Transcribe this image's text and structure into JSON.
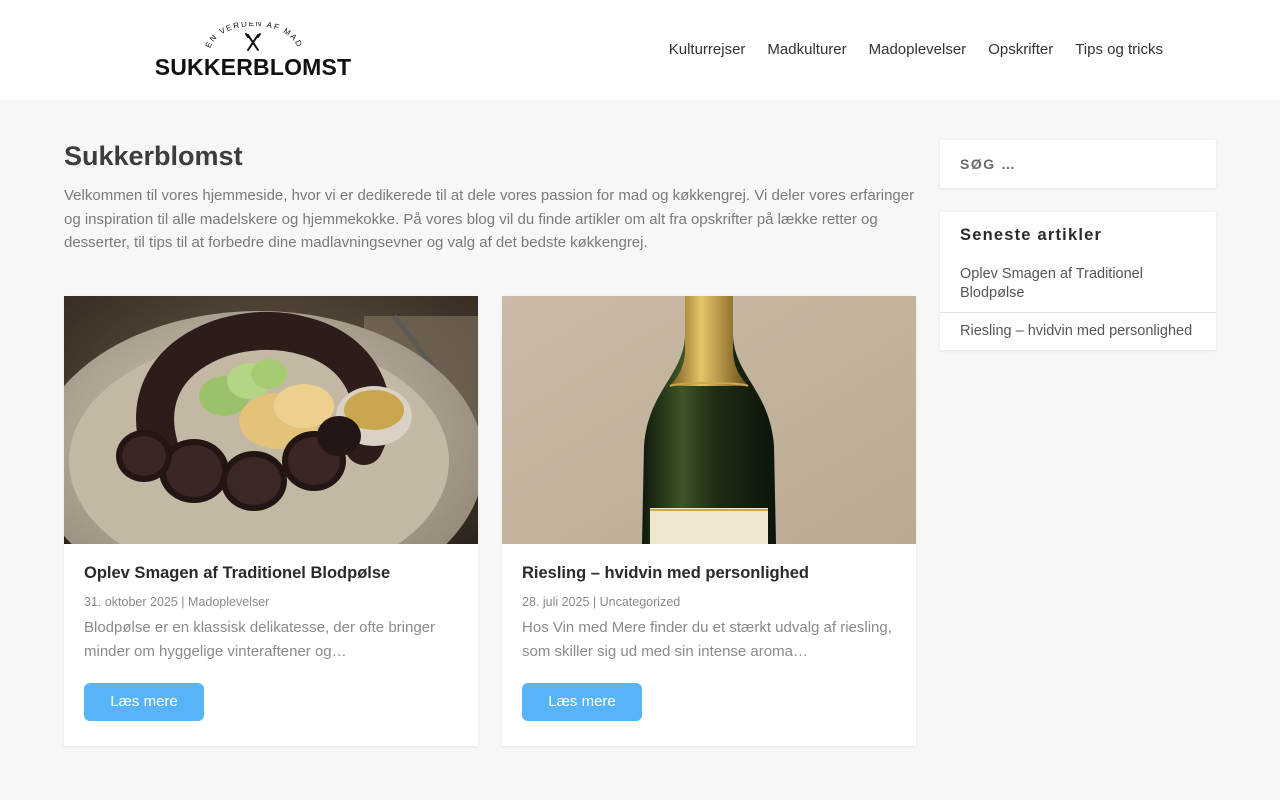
{
  "site": {
    "logo_tagline": "EN VERDEN AF MAD",
    "logo_name": "SUKKERBLOMST"
  },
  "nav": [
    "Kulturrejser",
    "Madkulturer",
    "Madoplevelser",
    "Opskrifter",
    "Tips og tricks"
  ],
  "main": {
    "title": "Sukkerblomst",
    "intro": "Velkommen til vores hjemmeside, hvor vi er dedikerede til at dele vores passion for mad og køkkengrej. Vi deler vores erfaringer og inspiration til alle madelskere og hjemmekokke. På vores blog vil du finde artikler om alt fra opskrifter på lække retter og desserter, til tips til at forbedre dine madlavningsevner og valg af det bedste køkkengrej."
  },
  "posts": [
    {
      "title": "Oplev Smagen af Traditionel Blodpølse",
      "date": "31. oktober 2025",
      "separator": " | ",
      "category": "Madoplevelser",
      "excerpt": "Blodpølse er en klassisk delikatesse, der ofte bringer minder om hyggelige vinteraftener og…",
      "button": "Læs mere",
      "image": "blood-sausage-plate-photo"
    },
    {
      "title": "Riesling – hvidvin med personlighed",
      "date": "28. juli 2025",
      "separator": " | ",
      "category": "Uncategorized",
      "excerpt": "Hos Vin med Mere finder du et stærkt udvalg af riesling, som skiller sig ud med sin intense aroma…",
      "button": "Læs mere",
      "image": "wine-bottle-photo"
    }
  ],
  "sidebar": {
    "search_placeholder": "SØG …",
    "recent_title": "Seneste artikler",
    "recent": [
      "Oplev Smagen af Traditionel Blodpølse",
      "Riesling – hvidvin med personlighed"
    ]
  },
  "colors": {
    "accent_button": "#56b4f7",
    "page_background": "#f7f7f7",
    "card_background": "#ffffff"
  }
}
